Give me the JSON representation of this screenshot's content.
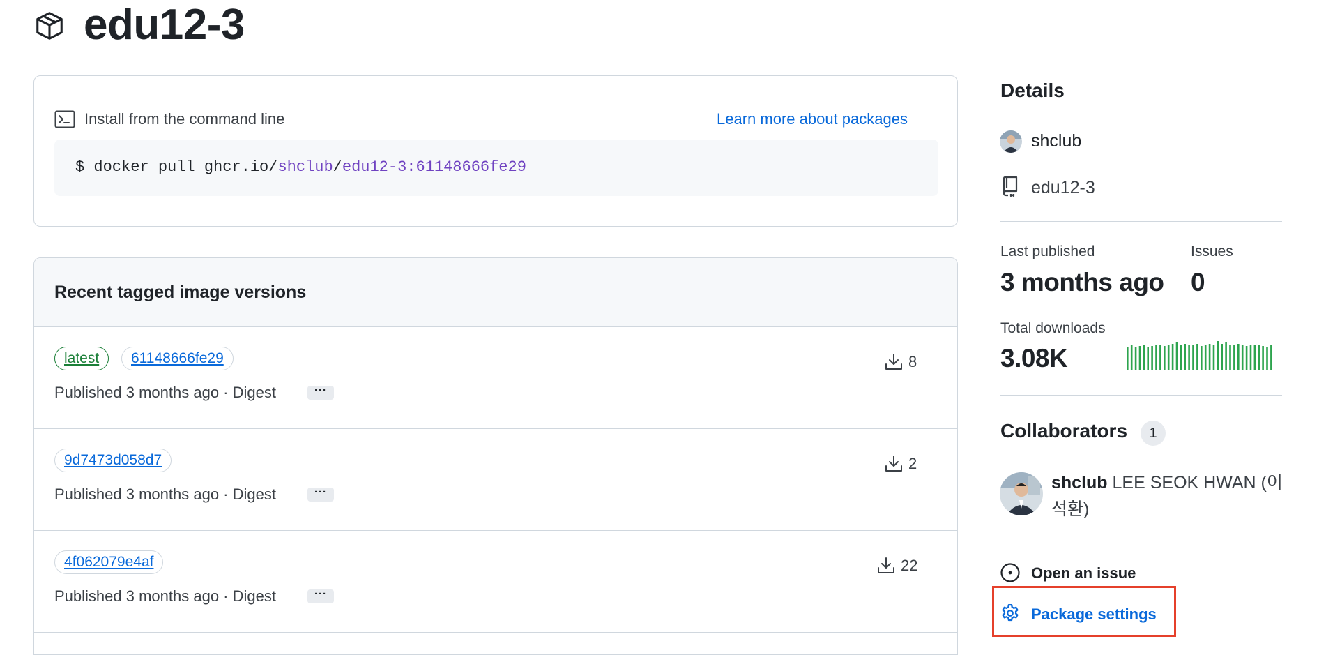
{
  "package": {
    "title": "edu12-3"
  },
  "install": {
    "label": "Install from the command line",
    "learn_more": "Learn more about packages",
    "cmd_prefix": "$ docker pull ghcr.io/",
    "cmd_owner": "shclub",
    "cmd_sep": "/",
    "cmd_image": "edu12-3:61148666fe29"
  },
  "versions": {
    "title": "Recent tagged image versions",
    "rows": [
      {
        "tags": [
          "latest",
          "61148666fe29"
        ],
        "published": "Published 3 months ago · Digest",
        "more": "···",
        "downloads": "8"
      },
      {
        "tags": [
          "9d7473d058d7"
        ],
        "published": "Published 3 months ago · Digest",
        "more": "···",
        "downloads": "2"
      },
      {
        "tags": [
          "4f062079e4af"
        ],
        "published": "Published 3 months ago · Digest",
        "more": "···",
        "downloads": "22"
      }
    ]
  },
  "details": {
    "heading": "Details",
    "owner": "shclub",
    "repo": "edu12-3",
    "last_published_label": "Last published",
    "last_published_value": "3 months ago",
    "issues_label": "Issues",
    "issues_value": "0",
    "downloads_label": "Total downloads",
    "downloads_value": "3.08K",
    "sparkline_color": "#2da44e"
  },
  "collaborators": {
    "heading": "Collaborators",
    "count": "1",
    "items": [
      {
        "login": "shclub",
        "name": "LEE SEOK HWAN (이석환)"
      }
    ]
  },
  "actions": {
    "open_issue": "Open an issue",
    "package_settings": "Package settings"
  },
  "icons": [
    "package-icon",
    "terminal-icon",
    "download-icon",
    "repo-icon",
    "issue-opened-icon",
    "gear-icon"
  ],
  "colors": {
    "link": "#0969da",
    "success": "#1a7f37",
    "highlight_box": "#e5402b"
  }
}
